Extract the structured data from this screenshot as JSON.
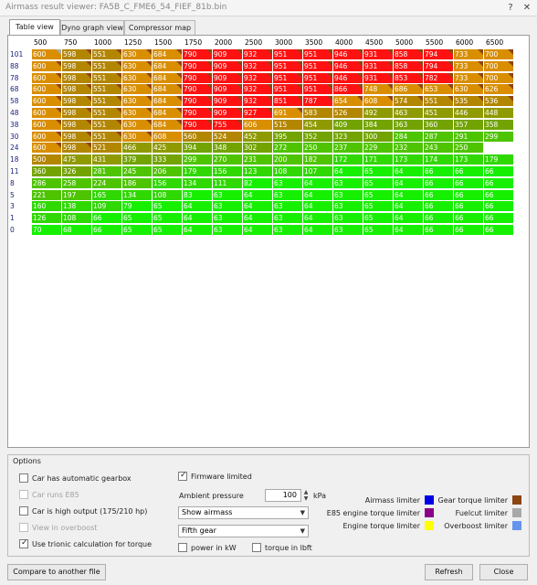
{
  "window": {
    "title": "Airmass result viewer: FA5B_C_FME6_54_FIEF_81b.bin",
    "help_label": "?",
    "close_label": "✕"
  },
  "tabs": [
    {
      "label": "Table view",
      "active": true
    },
    {
      "label": "Dyno graph view",
      "active": false
    },
    {
      "label": "Compressor map",
      "active": false
    }
  ],
  "table": {
    "columns": [
      "500",
      "750",
      "1000",
      "1250",
      "1500",
      "1750",
      "2000",
      "2500",
      "3000",
      "3500",
      "4000",
      "4500",
      "5000",
      "5500",
      "6000",
      "6500"
    ],
    "rows": [
      {
        "label": "101",
        "values": [
          600,
          598,
          551,
          630,
          684,
          790,
          909,
          932,
          951,
          951,
          946,
          931,
          858,
          794,
          733,
          700
        ],
        "limiters": [
          "fuelcut",
          "gear",
          "gear",
          "gear",
          "gear",
          "gear",
          "gear",
          "gear",
          "gear",
          "gear",
          "gear",
          "gear",
          "gear",
          "gear",
          "gear",
          "gear"
        ]
      },
      {
        "label": "88",
        "values": [
          600,
          598,
          551,
          630,
          684,
          790,
          909,
          932,
          951,
          951,
          946,
          931,
          858,
          794,
          733,
          700
        ],
        "limiters": [
          "gear",
          "gear",
          "gear",
          "gear",
          "gear",
          "gear",
          "gear",
          "gear",
          "gear",
          "gear",
          "gear",
          "gear",
          "gear",
          "gear",
          "gear",
          "gear"
        ]
      },
      {
        "label": "78",
        "values": [
          600,
          598,
          551,
          630,
          684,
          790,
          909,
          932,
          951,
          951,
          946,
          931,
          853,
          782,
          733,
          700
        ],
        "limiters": [
          "gear",
          "gear",
          "gear",
          "gear",
          "gear",
          "gear",
          "gear",
          "gear",
          "gear",
          "gear",
          "gear",
          "gear",
          "gear",
          "gear",
          "gear",
          "gear"
        ]
      },
      {
        "label": "68",
        "values": [
          600,
          598,
          551,
          630,
          684,
          790,
          909,
          932,
          951,
          951,
          866,
          748,
          686,
          653,
          630,
          626
        ],
        "limiters": [
          "gear",
          "gear",
          "gear",
          "gear",
          "gear",
          "gear",
          "gear",
          "gear",
          "gear",
          "gear",
          "gear",
          "gear",
          "gear",
          "gear",
          "gear",
          "gear"
        ]
      },
      {
        "label": "58",
        "values": [
          600,
          598,
          551,
          630,
          684,
          790,
          909,
          932,
          851,
          787,
          654,
          608,
          574,
          551,
          535,
          536
        ],
        "limiters": [
          "gear",
          "gear",
          "gear",
          "gear",
          "gear",
          "gear",
          "gear",
          "gear",
          "gear",
          "gear",
          "gear",
          "gear",
          "gear",
          "gear",
          "gear",
          "gear"
        ]
      },
      {
        "label": "48",
        "values": [
          600,
          598,
          551,
          630,
          684,
          790,
          909,
          927,
          691,
          583,
          526,
          492,
          463,
          451,
          446,
          448
        ],
        "limiters": [
          "gear",
          "gear",
          "gear",
          "gear",
          "gear",
          "gear",
          "gear",
          "gear",
          "gear",
          "none",
          "none",
          "none",
          "none",
          "none",
          "none",
          "none"
        ]
      },
      {
        "label": "38",
        "values": [
          600,
          598,
          551,
          630,
          684,
          790,
          755,
          606,
          515,
          454,
          409,
          384,
          363,
          360,
          357,
          358
        ],
        "limiters": [
          "gear",
          "gear",
          "gear",
          "gear",
          "gear",
          "gear",
          "gear",
          "none",
          "none",
          "none",
          "none",
          "none",
          "none",
          "none",
          "none",
          "none"
        ]
      },
      {
        "label": "30",
        "values": [
          600,
          598,
          551,
          630,
          608,
          560,
          524,
          452,
          395,
          352,
          323,
          300,
          284,
          287,
          291,
          299
        ],
        "limiters": [
          "gear",
          "gear",
          "gear",
          "gear",
          "none",
          "none",
          "none",
          "none",
          "none",
          "none",
          "none",
          "none",
          "none",
          "none",
          "none",
          "none"
        ]
      },
      {
        "label": "24",
        "values": [
          600,
          598,
          521,
          466,
          425,
          394,
          348,
          302,
          272,
          250,
          237,
          229,
          232,
          243,
          250
        ],
        "limiters": [
          "gear",
          "gear",
          "none",
          "none",
          "none",
          "none",
          "none",
          "none",
          "none",
          "none",
          "none",
          "none",
          "none",
          "none",
          "none"
        ]
      },
      {
        "label": "18",
        "values": [
          500,
          475,
          431,
          379,
          333,
          299,
          270,
          231,
          200,
          182,
          172,
          171,
          173,
          174,
          173,
          179
        ],
        "limiters": []
      },
      {
        "label": "11",
        "values": [
          360,
          326,
          281,
          245,
          206,
          179,
          156,
          123,
          108,
          107,
          64,
          65,
          64,
          66,
          66,
          66
        ],
        "limiters": []
      },
      {
        "label": "8",
        "values": [
          286,
          258,
          224,
          186,
          156,
          134,
          111,
          82,
          63,
          64,
          63,
          65,
          64,
          66,
          66,
          66
        ],
        "limiters": []
      },
      {
        "label": "5",
        "values": [
          221,
          197,
          165,
          134,
          108,
          83,
          63,
          64,
          63,
          64,
          63,
          65,
          64,
          66,
          66,
          66
        ],
        "limiters": []
      },
      {
        "label": "3",
        "values": [
          160,
          138,
          109,
          79,
          65,
          64,
          63,
          64,
          63,
          64,
          63,
          65,
          64,
          66,
          66,
          66
        ],
        "limiters": []
      },
      {
        "label": "1",
        "values": [
          126,
          108,
          66,
          65,
          65,
          64,
          63,
          64,
          63,
          64,
          63,
          65,
          64,
          66,
          66,
          66
        ],
        "limiters": []
      },
      {
        "label": "0",
        "values": [
          70,
          68,
          66,
          65,
          65,
          64,
          63,
          64,
          63,
          64,
          63,
          65,
          64,
          66,
          66,
          66
        ],
        "limiters": []
      }
    ]
  },
  "options": {
    "title": "Options",
    "automatic_gearbox": {
      "label": "Car has automatic gearbox",
      "checked": false,
      "enabled": true
    },
    "runs_e85": {
      "label": "Car runs E85",
      "checked": false,
      "enabled": false
    },
    "high_output": {
      "label": "Car is high output (175/210 hp)",
      "checked": false,
      "enabled": true
    },
    "view_overboost": {
      "label": "View in overboost",
      "checked": false,
      "enabled": false
    },
    "trionic_calc": {
      "label": "Use trionic calculation for torque",
      "checked": true,
      "enabled": true
    },
    "firmware_limited": {
      "label": "Firmware limited",
      "checked": true,
      "enabled": true
    },
    "ambient_pressure": {
      "label": "Ambient pressure",
      "value": "100",
      "unit": "kPa"
    },
    "view_select": {
      "value": "Show airmass"
    },
    "gear_select": {
      "value": "Fifth gear"
    },
    "power_kw": {
      "label": "power in kW",
      "checked": false
    },
    "torque_lbft": {
      "label": "torque in lbft",
      "checked": false
    },
    "legend": [
      {
        "label": "Airmass limiter",
        "color": "#0000e6"
      },
      {
        "label": "E85 engine torque limiter",
        "color": "#8b008b"
      },
      {
        "label": "Engine torque limiter",
        "color": "#ffff00"
      },
      {
        "label": "Gear torque limiter",
        "color": "#8b4513"
      },
      {
        "label": "Fuelcut limiter",
        "color": "#a9a9a9"
      },
      {
        "label": "Overboost limiter",
        "color": "#6495ed"
      }
    ]
  },
  "buttons": {
    "compare": "Compare to another file",
    "refresh": "Refresh",
    "close": "Close"
  }
}
